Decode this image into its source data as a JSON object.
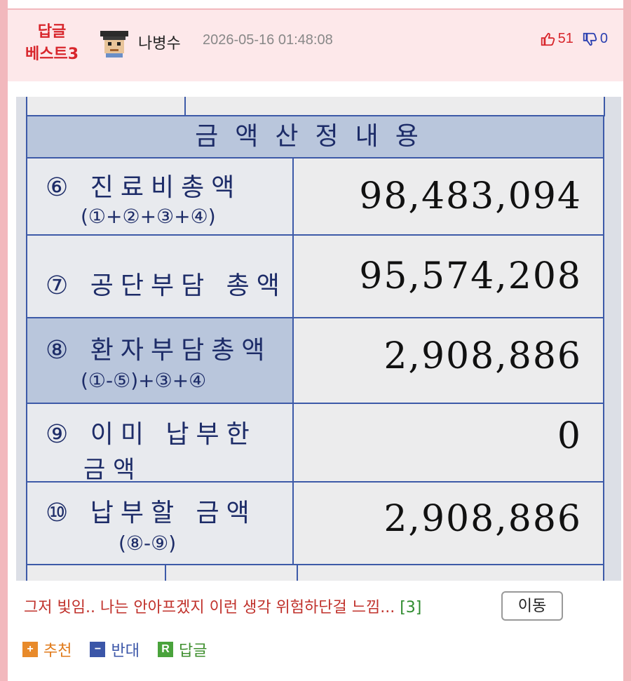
{
  "post": {
    "badge_line1": "답글",
    "badge_line2": "베스트3",
    "author": "나병수",
    "date": "2026-05-16 01:48:08",
    "upvotes": "51",
    "downvotes": "0"
  },
  "photo": {
    "heading": "금액산정내용",
    "rows": [
      {
        "label": "⑥ 진료비총액",
        "sub": "(①+②+③+④)",
        "amount": "98,483,094"
      },
      {
        "label": "⑦ 공단부담 총액",
        "sub": "",
        "amount": "95,574,208"
      },
      {
        "label": "⑧ 환자부담총액",
        "sub": "(①-⑤)+③+④",
        "amount": "2,908,886"
      },
      {
        "label": "⑨ 이미  납부한",
        "sub": "금          액",
        "amount": "0"
      },
      {
        "label": "⑩ 납부할  금액",
        "sub": "(⑧-⑨)",
        "amount": "2,908,886"
      }
    ]
  },
  "caption": {
    "text": "그저 빛임.. 나는 안아프겠지 이런 생각 위험하단걸 느낌...",
    "comment_count": "[3]",
    "move_label": "이동"
  },
  "actions": {
    "recommend": "추천",
    "oppose": "반대",
    "reply": "답글"
  },
  "colors": {
    "accent_red": "#d8262c",
    "header_bg": "#fde8ea",
    "page_border": "#f2b8bd",
    "down_blue": "#2a3fb0"
  }
}
